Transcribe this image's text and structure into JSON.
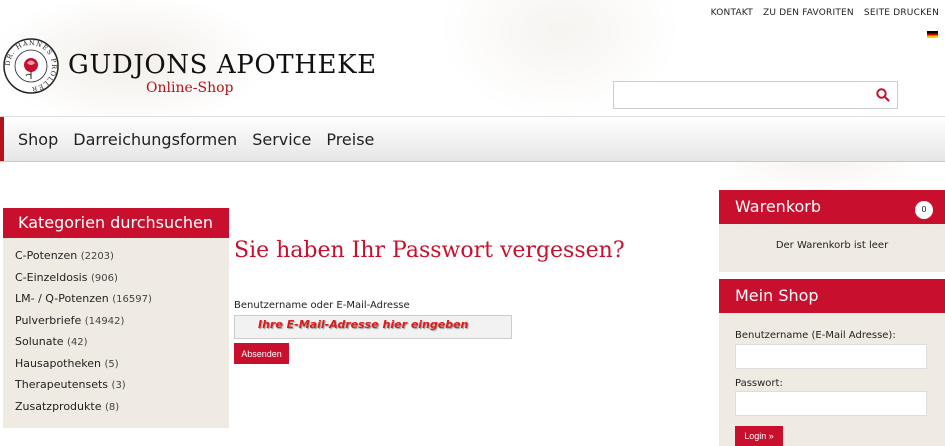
{
  "topnav": {
    "contact": "KONTAKT",
    "favorites": "ZU DEN FAVORITEN",
    "print": "SEITE DRUCKEN"
  },
  "logo": {
    "title": "GUDJONS APOTHEKE",
    "subtitle": "Online-Shop",
    "seal_text": "DR. HANNES PRÖLLER"
  },
  "search": {
    "placeholder": "",
    "icon": "search-icon"
  },
  "mainnav": {
    "items": [
      "Shop",
      "Darreichungsformen",
      "Service",
      "Preise"
    ]
  },
  "categories": {
    "heading": "Kategorien durchsuchen",
    "items": [
      {
        "name": "C-Potenzen",
        "count": "(2203)"
      },
      {
        "name": "C-Einzeldosis",
        "count": "(906)"
      },
      {
        "name": "LM- / Q-Potenzen",
        "count": "(16597)"
      },
      {
        "name": "Pulverbriefe",
        "count": "(14942)"
      },
      {
        "name": "Solunate",
        "count": "(42)"
      },
      {
        "name": "Hausapotheken",
        "count": "(5)"
      },
      {
        "name": "Therapeutensets",
        "count": "(3)"
      },
      {
        "name": "Zusatzprodukte",
        "count": "(8)"
      }
    ]
  },
  "forgot": {
    "title": "Sie haben Ihr Passwort vergessen?",
    "label": "Benutzername oder E-Mail-Adresse",
    "value": "",
    "hint": "Ihre E-Mail-Adresse hier eingeben",
    "submit": "Absenden"
  },
  "cart": {
    "heading": "Warenkorb",
    "count": "0",
    "empty_text": "Der Warenkorb ist leer"
  },
  "myshop": {
    "heading": "Mein Shop",
    "username_label": "Benutzername (E-Mail Adresse):",
    "password_label": "Passwort:",
    "login_label": "Login »"
  },
  "colors": {
    "accent": "#c8102e",
    "panel_bg": "#efeae2"
  }
}
